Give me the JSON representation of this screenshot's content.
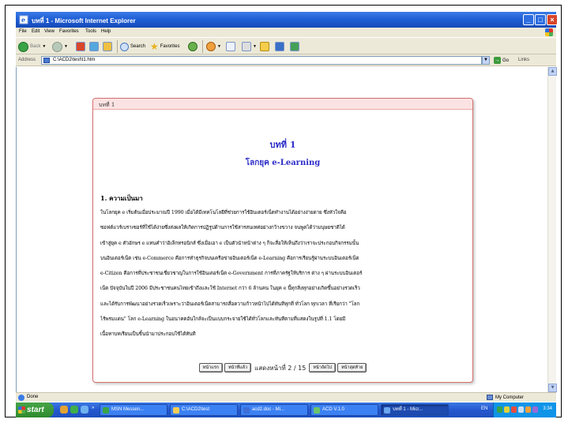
{
  "window": {
    "title": "บทที่ 1 - Microsoft Internet Explorer",
    "controls": {
      "minimize": "_",
      "maximize": "□",
      "close": "×"
    }
  },
  "menu": [
    "File",
    "Edit",
    "View",
    "Favorites",
    "Tools",
    "Help"
  ],
  "toolbar": {
    "back_label": "Back",
    "search_label": "Search",
    "favorites_label": "Favorites"
  },
  "address": {
    "label": "Address",
    "value": "C:\\ACD2\\test\\t1.htm",
    "go_label": "Go",
    "links_label": "Links"
  },
  "card": {
    "header": "บทที่ 1",
    "chapter_title": "บทที่ 1",
    "subtitle": "โลกยุค e-Learning",
    "section_heading": "1. ความเป็นมา",
    "lines": [
      "ในโลกยุค e เริ่มต้นเมื่อประมาณปี 1990 เมื่อได้มีเทคโนโลยีที่ช่วยการใช้อินเตอร์เน็ตทำงานได้อย่างง่ายดาย ซึ่งหัวใจคือ",
      "ซอฟต์แวร์เบราเซอร์ที่ใช้ได้ง่ายซึ่งส่งผลให้เกิดการปฏิรูปด้านการใช้สารสนเทศอย่างกว้างขวาง จนพูดได้ว่ามนุษยชาติได้",
      "เข้าสู่ยุค e ตัวอักษร e แทนคำว่าอิเล็กทรอนิกส์ ซึ่งเมื่อเอา e เป็นตัวนำหน้าต่าง ๆ ก็จะสื่อให้เห็นถึงว่าเราจะประกอบกิจกรรมนั้น",
      "บนอินเตอร์เน็ต เช่น e-Commerce คือการทำธุรกิจบนเครือข่ายอินเตอร์เน็ต e-Learning คือการเรียนรู้ผ่านระบบอินเตอร์เน็ต",
      "e-Citizen คือการที่ประชาชนเชี่ยวชาญในการใช้อินเตอร์เน็ต e-Government การที่ภาครัฐให้บริการ ต่าง ๆ ผ่านระบบอินเตอร์",
      "เน็ต ปัจจุบันในปี 2006 มีประชาชนคนไทยเข้าถึงและใช้ Internet กว่า 6 ล้านคน ในยุค e นี้ทุกสิ่งทุกอย่างเกิดขึ้นอย่างรวดเร็ว",
      "และได้รับการพัฒนาอย่างรวดเร็วเพราะว่าอินเตอร์เน็ตสามารถสื่อความก้าวหน้าไปได้ทันทีทุกที่ ทั่วโลก ทุกเวลา ที่เรียกว่า \"โลก",
      "ไร้พรมแดน\" โลก e-Learning ในอนาคตอันใกล้จะเป็นแบบกระจายใช้ได้ทั่วโลกและทันทีตามที่แสดงในรูปที่ 1.1 โดยมี",
      "เนื้อหาบทเรียนเป็นชิ้นนำมาประกอบใช้ได้ทันที"
    ],
    "pager": {
      "first": "หน้าแรก",
      "prev": "หน้าที่แล้ว",
      "info": "แสดงหน้าที่ 2 / 15",
      "next": "หน้าถัดไป",
      "last": "หน้าสุดท้าย"
    }
  },
  "status": {
    "text": "Done",
    "zone": "My Computer"
  },
  "taskbar": {
    "start_label": "start",
    "tasks": [
      "MSN Messen...",
      "C:\\ACD2\\test",
      "acd2.doc - Mi...",
      "ACD V.1.0",
      "บทที่ 1 - Micr..."
    ],
    "language": "EN",
    "clock": "3:34"
  },
  "colors": {
    "titlebar": "#1f5fd6",
    "card_border": "#d56d6d",
    "card_header_bg": "#fce3e3",
    "heading_blue": "#2c2cc8",
    "taskbar": "#2458cf",
    "start_green": "#2e8a2e"
  }
}
